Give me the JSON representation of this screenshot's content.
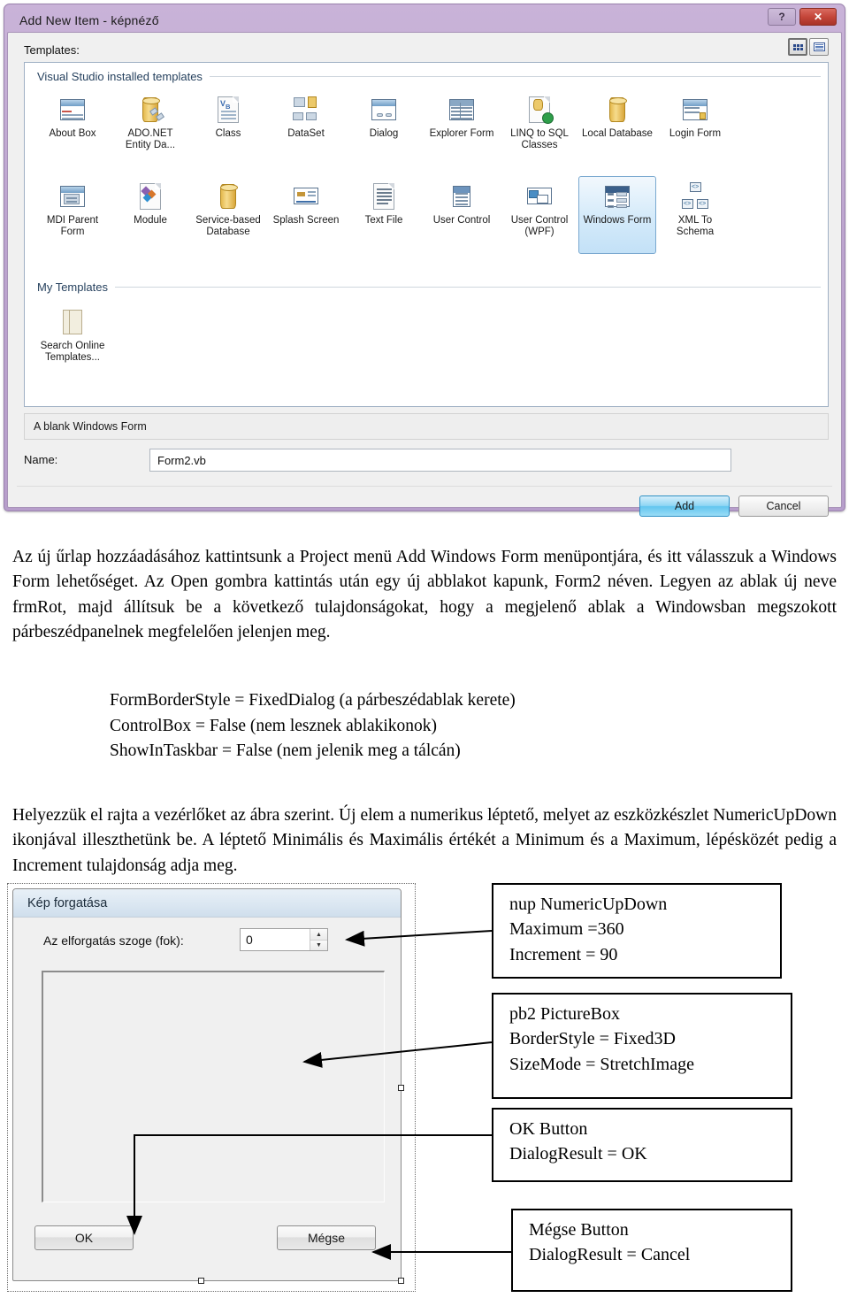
{
  "dialog": {
    "title": "Add New Item - képnéző",
    "help_button": "?",
    "close_button": "✕",
    "templates_label": "Templates:",
    "view_buttons": [
      "large-icons-view",
      "list-view"
    ],
    "groups": [
      {
        "name": "Visual Studio installed templates",
        "rows": [
          [
            {
              "label": "About Box",
              "icon": "about-box-icon"
            },
            {
              "label": "ADO.NET Entity Da...",
              "icon": "ado-net-entity-data-icon"
            },
            {
              "label": "Class",
              "icon": "class-icon"
            },
            {
              "label": "DataSet",
              "icon": "dataset-icon"
            },
            {
              "label": "Dialog",
              "icon": "dialog-icon"
            },
            {
              "label": "Explorer Form",
              "icon": "explorer-form-icon"
            },
            {
              "label": "LINQ to SQL Classes",
              "icon": "linq-to-sql-icon"
            },
            {
              "label": "Local Database",
              "icon": "local-database-icon"
            },
            {
              "label": "Login Form",
              "icon": "login-form-icon"
            }
          ],
          [
            {
              "label": "MDI Parent Form",
              "icon": "mdi-parent-form-icon"
            },
            {
              "label": "Module",
              "icon": "module-icon"
            },
            {
              "label": "Service-based Database",
              "icon": "service-based-database-icon"
            },
            {
              "label": "Splash Screen",
              "icon": "splash-screen-icon"
            },
            {
              "label": "Text File",
              "icon": "text-file-icon"
            },
            {
              "label": "User Control",
              "icon": "user-control-icon"
            },
            {
              "label": "User Control (WPF)",
              "icon": "user-control-wpf-icon"
            },
            {
              "label": "Windows Form",
              "icon": "windows-form-icon",
              "selected": true
            },
            {
              "label": "XML To Schema",
              "icon": "xml-to-schema-icon"
            }
          ]
        ]
      },
      {
        "name": "My Templates",
        "rows": [
          [
            {
              "label": "Search Online Templates...",
              "icon": "search-online-templates-icon"
            }
          ]
        ]
      }
    ],
    "description": "A blank Windows Form",
    "name_label": "Name:",
    "name_value": "Form2.vb",
    "add_label": "Add",
    "cancel_label": "Cancel"
  },
  "text": {
    "para1": "Az új űrlap hozzáadásához kattintsunk a Project menü Add Windows Form menüpontjára, és itt válasszuk a Windows Form lehetőséget. Az Open gombra kattintás után egy új abblakot kapunk, Form2 néven. Legyen az ablak új neve frmRot, majd állítsuk be a következő tulajdonságokat, hogy a megjelenő ablak a Windowsban megszokott párbeszédpanelnek megfelelően jelenjen meg.",
    "properties": [
      "FormBorderStyle = FixedDialog (a párbeszédablak kerete)",
      "ControlBox = False (nem lesznek ablakikonok)",
      "ShowInTaskbar = False (nem jelenik meg a tálcán)"
    ],
    "para2": "Helyezzük el rajta a vezérlőket az ábra szerint. Új elem a numerikus léptető, melyet az eszközkészlet NumericUpDown ikonjával illeszthetünk be. A léptető Minimális és Maximális értékét a Minimum és a Maximum, lépésközét pedig a Increment tulajdonság adja meg."
  },
  "mockform": {
    "title": "Kép forgatása",
    "angle_label": "Az elforgatás szoge (fok):",
    "angle_value": "0",
    "spin_up": "▲",
    "spin_down": "▼",
    "ok_label": "OK",
    "cancel_label": "Mégse"
  },
  "annotations": [
    {
      "id": "nup",
      "lines": [
        "nup NumericUpDown",
        "Maximum =360",
        "Increment = 90"
      ]
    },
    {
      "id": "pb",
      "lines": [
        "pb2 PictureBox",
        "BorderStyle = Fixed3D",
        "SizeMode = StretchImage"
      ]
    },
    {
      "id": "ok",
      "lines": [
        "OK Button",
        "DialogResult = OK"
      ]
    },
    {
      "id": "cancel",
      "lines": [
        "Mégse Button",
        "DialogResult = Cancel"
      ]
    }
  ],
  "colors": {
    "titlebar": "#bda5cf",
    "close_button": "#c4463a",
    "selected_template": "#c3e1f7",
    "add_button": "#62c6ef",
    "mockform_titlebar": "#dbe7f2"
  }
}
